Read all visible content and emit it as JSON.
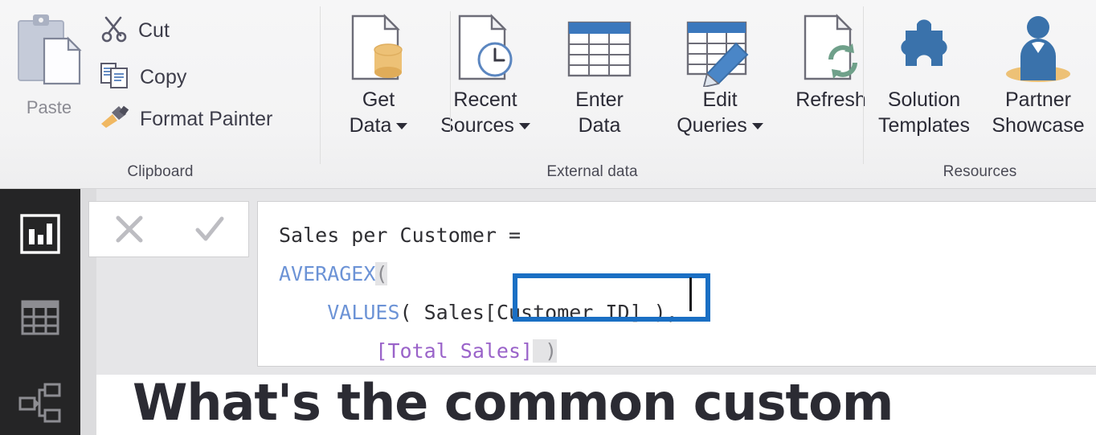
{
  "ribbon": {
    "groups": [
      {
        "id": "clipboard",
        "label": "Clipboard"
      },
      {
        "id": "external-data",
        "label": "External data"
      },
      {
        "id": "resources",
        "label": "Resources"
      }
    ],
    "clipboard": {
      "paste_label": "Paste",
      "paste_icon": "clipboard-icon",
      "cut_label": "Cut",
      "cut_icon": "scissors-icon",
      "copy_label": "Copy",
      "copy_icon": "copy-icon",
      "format_painter_label": "Format Painter",
      "format_painter_icon": "paintbrush-icon"
    },
    "external_data": {
      "get_data_line1": "Get",
      "get_data_line2": "Data",
      "get_data_icon": "database-page-icon",
      "recent_sources_line1": "Recent",
      "recent_sources_line2": "Sources",
      "recent_sources_icon": "page-clock-icon",
      "enter_data_line1": "Enter",
      "enter_data_line2": "Data",
      "enter_data_icon": "table-icon",
      "edit_queries_line1": "Edit",
      "edit_queries_line2": "Queries",
      "edit_queries_icon": "table-pencil-icon",
      "refresh_line1": "Refresh",
      "refresh_line2": "",
      "refresh_icon": "page-refresh-icon"
    },
    "resources": {
      "solution_templates_line1": "Solution",
      "solution_templates_line2": "Templates",
      "solution_templates_icon": "puzzle-piece-icon",
      "partner_showcase_line1": "Partner",
      "partner_showcase_line2": "Showcase",
      "partner_showcase_icon": "person-icon"
    }
  },
  "sidebar": {
    "items": [
      {
        "id": "report",
        "name": "report-view",
        "icon": "bar-chart-icon",
        "selected": true
      },
      {
        "id": "data",
        "name": "data-view",
        "icon": "table-grid-icon",
        "selected": false
      },
      {
        "id": "model",
        "name": "model-view",
        "icon": "relationships-icon",
        "selected": false
      }
    ]
  },
  "formula_bar": {
    "cancel_icon": "x-icon",
    "accept_icon": "checkmark-icon",
    "measure_name": "Sales per Customer =",
    "line2_fn": "AVERAGEX",
    "line2_paren": "(",
    "line3_indent": "    ",
    "line3_fn": "VALUES",
    "line3_rest": "( Sales[Customer ID] ),",
    "line4_indent": "        ",
    "line4_measure": "[Total Sales]",
    "line4_paren": " )",
    "full_text": "Sales per Customer =\nAVERAGEX(\n    VALUES( Sales[Customer ID] ),\n        [Total Sales] )",
    "highlight_text": "Customer ID"
  },
  "annotation": {
    "highlight_color": "#1a6fc4",
    "target": "Sales[Customer ID]"
  },
  "canvas": {
    "title": "What's the common custom"
  },
  "colors": {
    "ribbon_bg": "#f3f3f4",
    "sidebar_bg": "#252526",
    "workspace_bg": "#e6e6e8",
    "accent_blue": "#1a6fc4",
    "dax_function": "#6c93d6",
    "dax_measure": "#9a63c9",
    "icon_blue": "#3a72ab",
    "icon_gold": "#e9bd6a",
    "icon_green": "#6fa08a"
  }
}
